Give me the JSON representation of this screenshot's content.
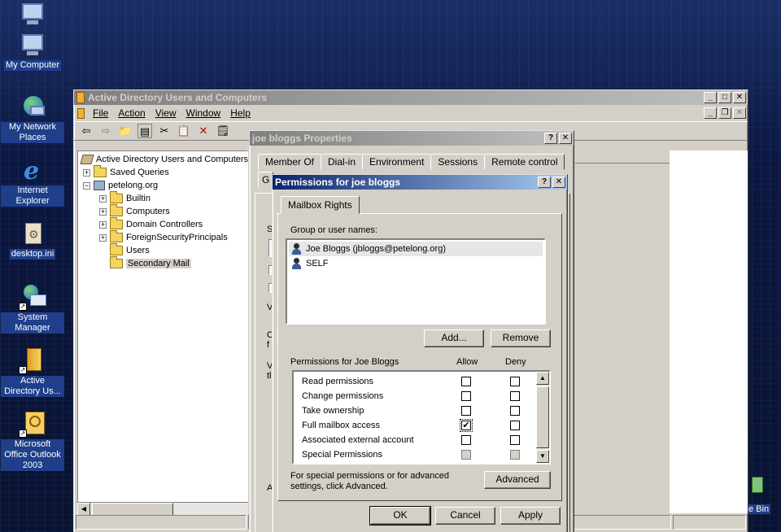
{
  "desktop": {
    "icons": [
      {
        "label": "",
        "icon": "computer-icon"
      },
      {
        "label": "My Computer",
        "icon": "computer-icon"
      },
      {
        "label": "My Network Places",
        "icon": "network-places-icon"
      },
      {
        "label": "Internet Explorer",
        "icon": "internet-explorer-icon"
      },
      {
        "label": "desktop.ini",
        "icon": "settings-file-icon"
      },
      {
        "label": "System Manager",
        "icon": "system-manager-icon"
      },
      {
        "label": "Active Directory Us...",
        "icon": "active-directory-icon"
      },
      {
        "label": "Microsoft Office Outlook 2003",
        "icon": "outlook-icon"
      }
    ],
    "recycle_label": "e Bin"
  },
  "ad_window": {
    "title": "Active Directory Users and Computers",
    "menu": [
      "File",
      "Action",
      "View",
      "Window",
      "Help"
    ],
    "tree": {
      "root": "Active Directory Users and Computers",
      "saved_queries": "Saved Queries",
      "domain": "petelong.org",
      "children": [
        "Builtin",
        "Computers",
        "Domain Controllers",
        "ForeignSecurityPrincipals",
        "Users",
        "Secondary Mail"
      ]
    }
  },
  "props_window": {
    "title": "joe bloggs Properties",
    "tabs": [
      "Member Of",
      "Dial-in",
      "Environment",
      "Sessions",
      "Remote control"
    ],
    "fragments": [
      "G",
      "S",
      "V",
      "C",
      "f",
      "V",
      "tl",
      "A"
    ]
  },
  "perm_dialog": {
    "title": "Permissions for joe bloggs",
    "tab": "Mailbox Rights",
    "group_label": "Group or user names:",
    "users": [
      {
        "name": "Joe Bloggs (jbloggs@petelong.org)"
      },
      {
        "name": "SELF"
      }
    ],
    "add_label": "Add...",
    "remove_label": "Remove",
    "perms_for_label": "Permissions for Joe Bloggs",
    "allow_label": "Allow",
    "deny_label": "Deny",
    "permissions": [
      {
        "name": "Read permissions",
        "allow": "",
        "deny": ""
      },
      {
        "name": "Change permissions",
        "allow": "",
        "deny": ""
      },
      {
        "name": "Take ownership",
        "allow": "",
        "deny": ""
      },
      {
        "name": "Full mailbox access",
        "allow": "✔",
        "deny": ""
      },
      {
        "name": "Associated external account",
        "allow": "",
        "deny": ""
      },
      {
        "name": "Special Permissions",
        "allow": "",
        "deny": ""
      }
    ],
    "advanced_note": "For special permissions or for advanced settings, click Advanced.",
    "advanced_label": "Advanced",
    "ok_label": "OK",
    "cancel_label": "Cancel",
    "apply_label": "Apply"
  }
}
